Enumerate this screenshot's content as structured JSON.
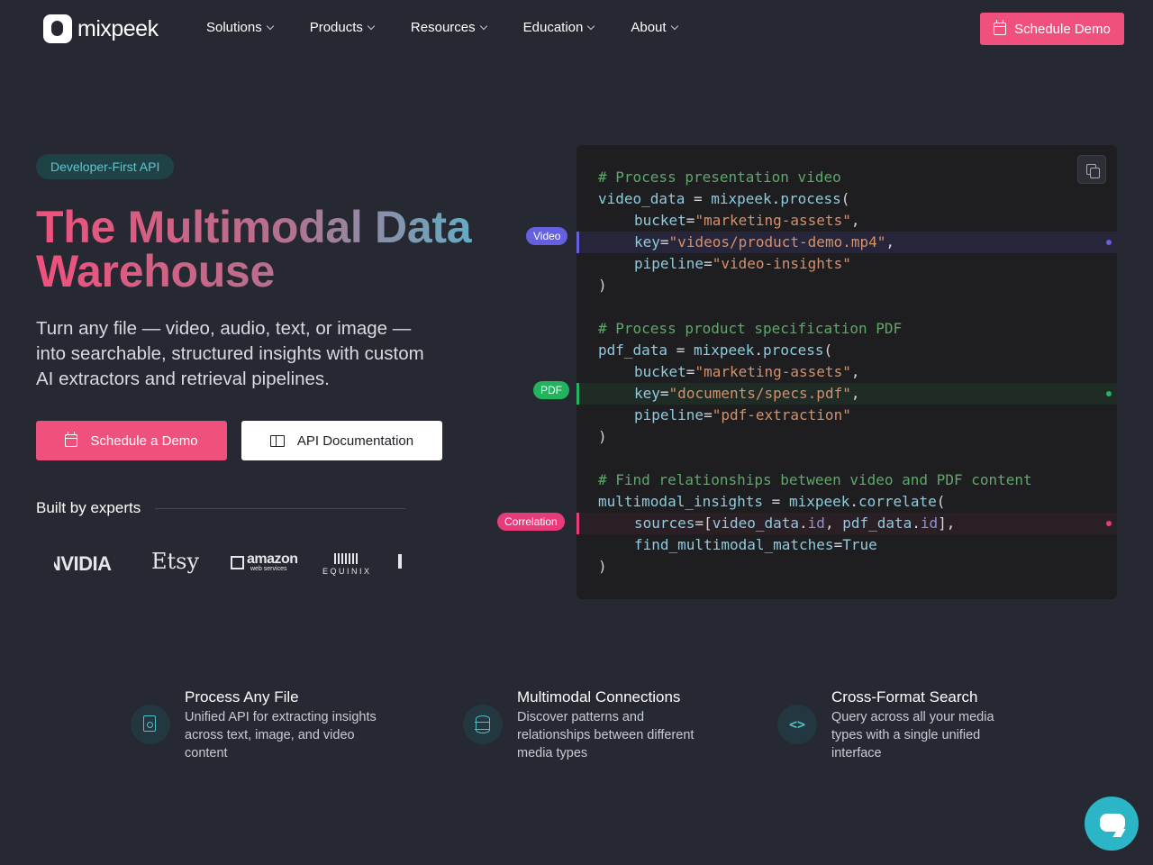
{
  "nav": {
    "logo_text": "mixpeek",
    "items": [
      {
        "label": "Solutions"
      },
      {
        "label": "Products"
      },
      {
        "label": "Resources"
      },
      {
        "label": "Education"
      },
      {
        "label": "About"
      }
    ],
    "cta_label": "Schedule Demo"
  },
  "hero": {
    "badge": "Developer-First API",
    "title_line1": "The Multimodal Data",
    "title_line2": "Warehouse",
    "subtitle": "Turn any file — video, audio, text, or image — into searchable, structured insights with custom AI extractors and retrieval pipelines.",
    "primary_button": "Schedule a Demo",
    "secondary_button": "API Documentation",
    "experts_label": "Built by experts",
    "logos": {
      "nvidia": "NVIDIA",
      "etsy": "Etsy",
      "amazon": "amazon",
      "amazon_sub": "web services",
      "equinix": "EQUINIX"
    }
  },
  "code": {
    "tags": {
      "video": "Video",
      "pdf": "PDF",
      "correlation": "Correlation"
    },
    "colors": {
      "video": "#6560e0",
      "pdf": "#22b35f",
      "correlation": "#e83c7a"
    },
    "l1": "# Process presentation video",
    "l2_var": "video_data",
    "l2_mid": " = ",
    "l2_obj": "mixpeek",
    "l2_dot": ".",
    "l2_fn": "process",
    "l2_end": "(",
    "l3_key": "bucket",
    "l3_eq": "=",
    "l3_val": "\"marketing-assets\"",
    "l3_end": ",",
    "l4_key": "key",
    "l4_eq": "=",
    "l4_val": "\"videos/product-demo.mp4\"",
    "l4_end": ",",
    "l5_key": "pipeline",
    "l5_eq": "=",
    "l5_val": "\"video-insights\"",
    "l6": ")",
    "l8": "# Process product specification PDF",
    "l9_var": "pdf_data",
    "l9_mid": " = ",
    "l9_obj": "mixpeek",
    "l9_dot": ".",
    "l9_fn": "process",
    "l9_end": "(",
    "l10_key": "bucket",
    "l10_eq": "=",
    "l10_val": "\"marketing-assets\"",
    "l10_end": ",",
    "l11_key": "key",
    "l11_eq": "=",
    "l11_val": "\"documents/specs.pdf\"",
    "l11_end": ",",
    "l12_key": "pipeline",
    "l12_eq": "=",
    "l12_val": "\"pdf-extraction\"",
    "l13": ")",
    "l15": "# Find relationships between video and PDF content",
    "l16_var": "multimodal_insights",
    "l16_mid": " = ",
    "l16_obj": "mixpeek",
    "l16_dot": ".",
    "l16_fn": "correlate",
    "l16_end": "(",
    "l17_key": "sources",
    "l17_eq": "=[",
    "l17_a": "video_data",
    "l17_dot1": ".",
    "l17_id1": "id",
    "l17_sep": ", ",
    "l17_b": "pdf_data",
    "l17_dot2": ".",
    "l17_id2": "id",
    "l17_end": "],",
    "l18_key": "find_multimodal_matches",
    "l18_eq": "=",
    "l18_val": "True",
    "l19": ")"
  },
  "features": [
    {
      "title": "Process Any File",
      "desc": "Unified API for extracting insights across text, image, and video content",
      "icon": "file-search-icon"
    },
    {
      "title": "Multimodal Connections",
      "desc": "Discover patterns and relationships between different media types",
      "icon": "database-icon"
    },
    {
      "title": "Cross-Format Search",
      "desc": "Query across all your media types with a single unified interface",
      "icon": "code-icon"
    }
  ],
  "chat": {
    "icon": "chat-icon"
  }
}
